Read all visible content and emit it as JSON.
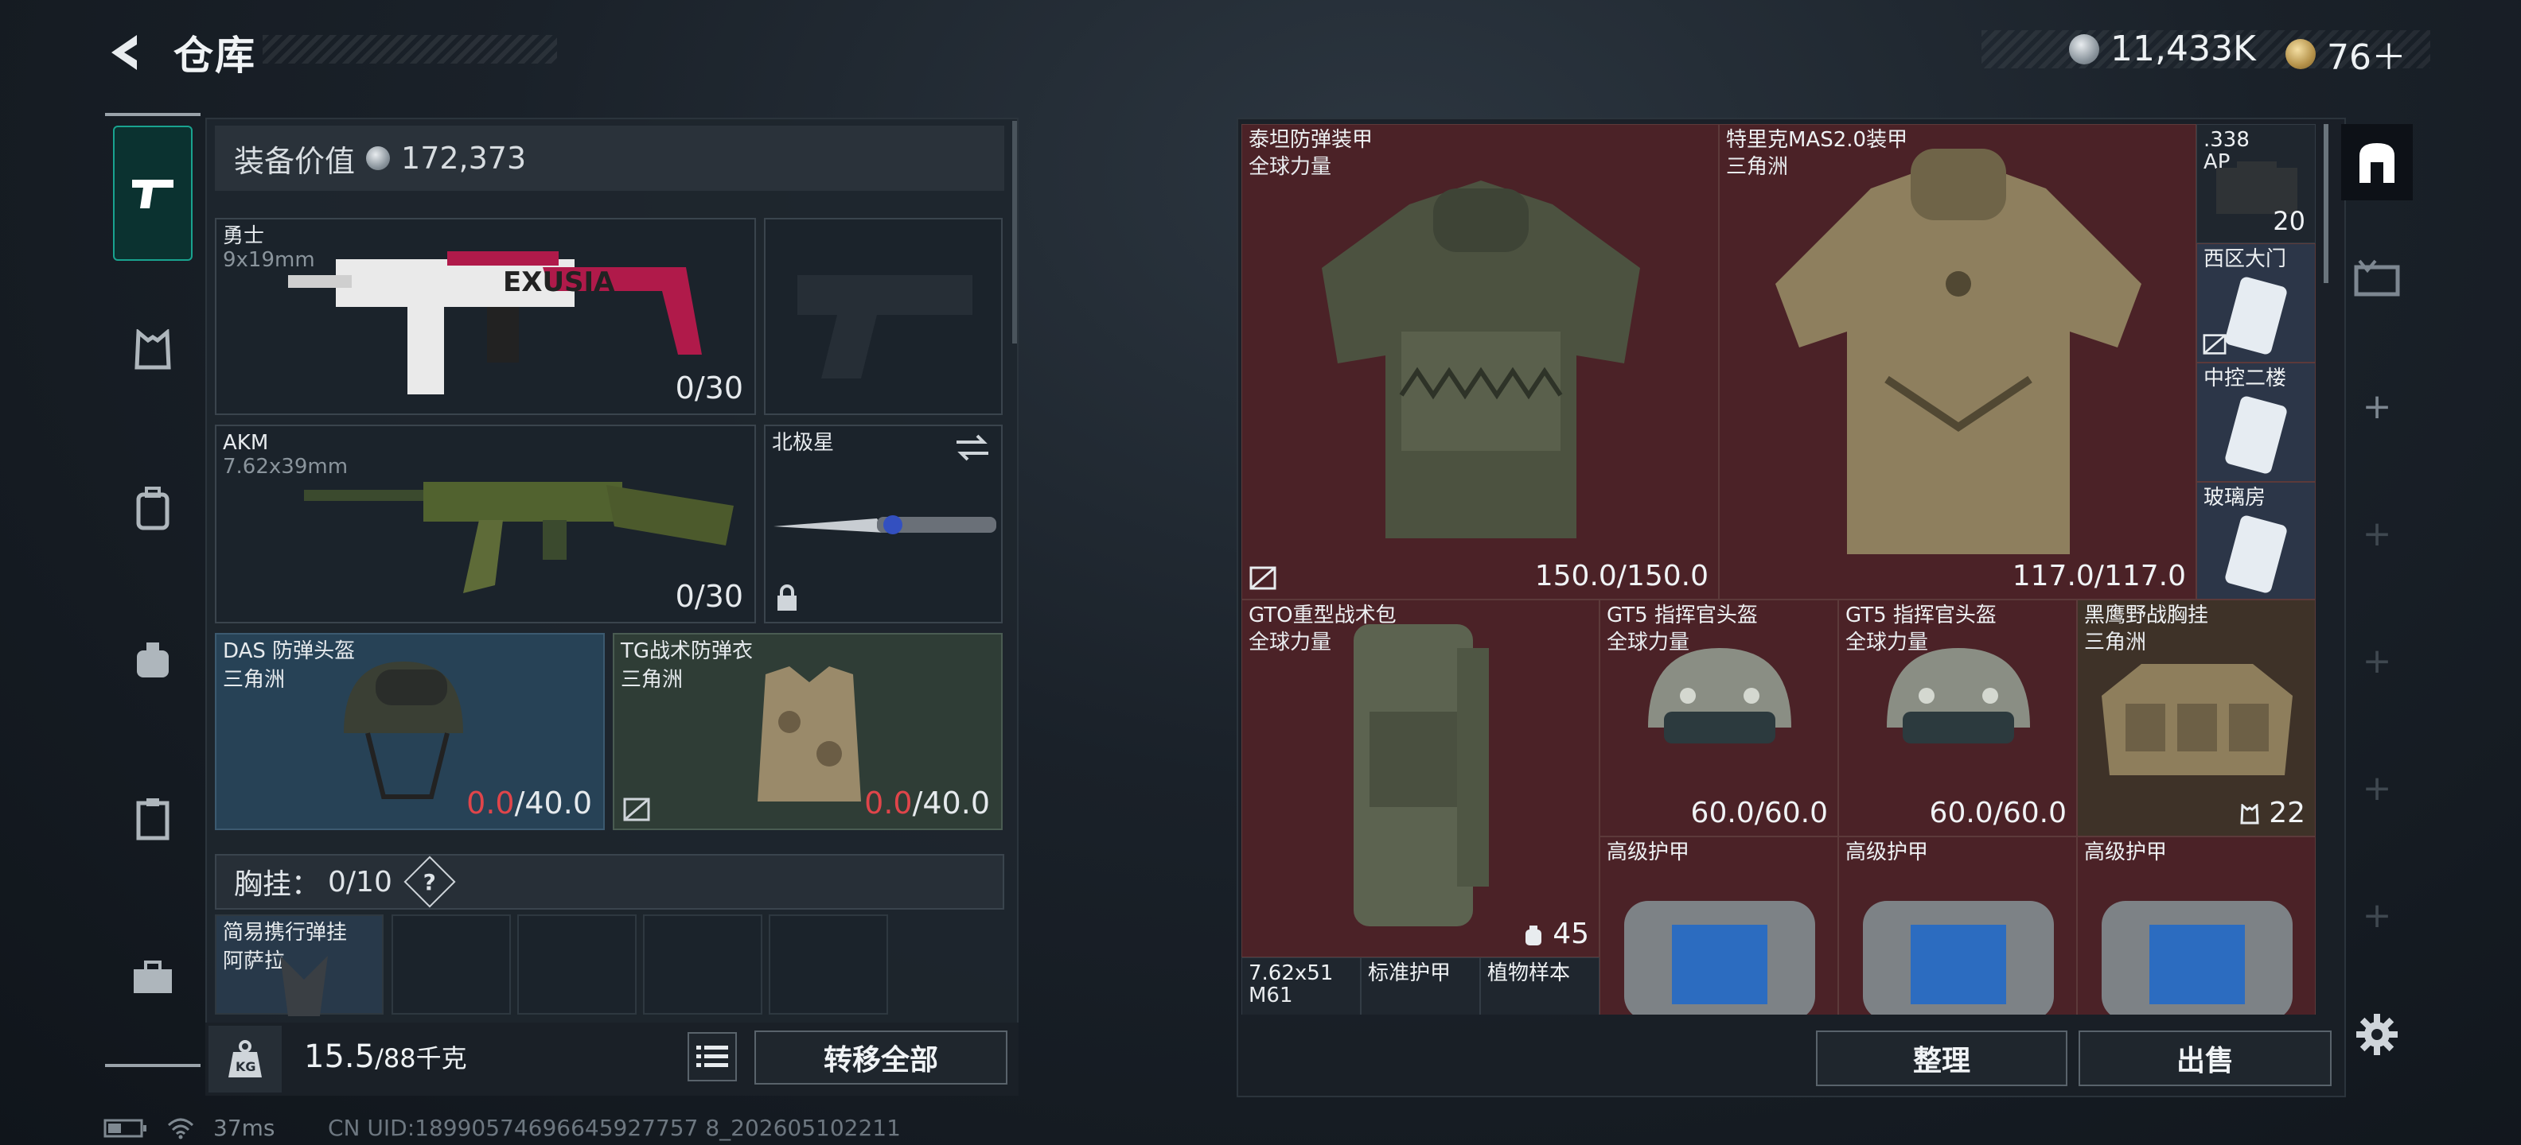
{
  "header": {
    "title": "仓库"
  },
  "currency": {
    "silver": "11,433K",
    "gold": "76＋"
  },
  "equipment_value": {
    "label": "装备价值",
    "amount": "172,373"
  },
  "weapons": [
    {
      "name": "勇士",
      "ammo_type": "9x19mm",
      "ammo": "0/30"
    },
    {
      "name": "AKM",
      "ammo_type": "7.62x39mm",
      "ammo": "0/30"
    }
  ],
  "melee": {
    "name": "北极星"
  },
  "helmet": {
    "name": "DAS 防弹头盔",
    "faction": "三角洲",
    "durability_current": "0.0",
    "durability_max": "/40.0"
  },
  "armor": {
    "name": "TG战术防弹衣",
    "faction": "三角洲",
    "durability_current": "0.0",
    "durability_max": "/40.0"
  },
  "chest_rig": {
    "label": "胸挂：",
    "capacity": "0/10",
    "help": "?",
    "slot_item": "简易携行弹挂",
    "slot_sub": "阿萨拉"
  },
  "weight": {
    "current": "15.5",
    "max": "/88千克"
  },
  "buttons": {
    "transfer_all": "转移全部",
    "organize": "整理",
    "sell": "出售"
  },
  "stash_items": [
    {
      "name": "泰坦防弹装甲",
      "sub": "全球力量",
      "value": "150.0/150.0"
    },
    {
      "name": "特里克MAS2.0装甲",
      "sub": "三角洲",
      "value": "117.0/117.0"
    },
    {
      "name": ".338",
      "sub": "AP",
      "value": "20"
    },
    {
      "name": "西区大门",
      "sub": "",
      "value": ""
    },
    {
      "name": "中控二楼",
      "sub": "",
      "value": ""
    },
    {
      "name": "玻璃房",
      "sub": "",
      "value": ""
    },
    {
      "name": "GTO重型战术包",
      "sub": "全球力量",
      "value": "45"
    },
    {
      "name": "GT5 指挥官头盔",
      "sub": "全球力量",
      "value": "60.0/60.0"
    },
    {
      "name": "GT5 指挥官头盔",
      "sub": "全球力量",
      "value": "60.0/60.0"
    },
    {
      "name": "黑鹰野战胸挂",
      "sub": "三角洲",
      "value": "22"
    },
    {
      "name": "高级护甲",
      "sub": "",
      "value": ""
    },
    {
      "name": "高级护甲",
      "sub": "",
      "value": ""
    },
    {
      "name": "高级护甲",
      "sub": "",
      "value": ""
    },
    {
      "name": "7.62x51",
      "sub": "M61",
      "value": ""
    },
    {
      "name": "标准护甲",
      "sub": "",
      "value": ""
    },
    {
      "name": "植物样本",
      "sub": "",
      "value": ""
    }
  ],
  "status": {
    "ping": "37ms",
    "uid": "CN UID:18990574696645927757 8_202605102211"
  },
  "colors": {
    "accent": "#19a38f",
    "red_cell": "#4b2227",
    "brown_cell": "#3e3228",
    "blue_cell": "#2c3648",
    "low_durability": "#e0454a"
  }
}
